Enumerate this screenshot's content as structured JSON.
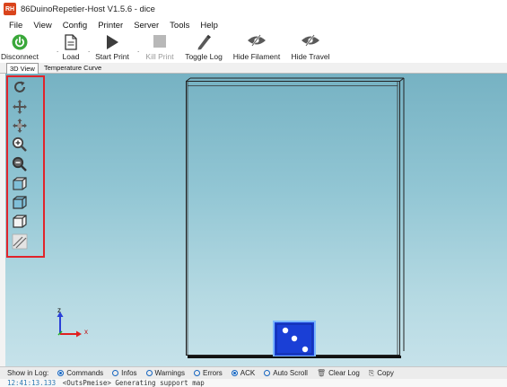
{
  "window": {
    "title": "86DuinoRepetier-Host V1.5.6 - dice",
    "app_icon": "app-logo-icon"
  },
  "menu": [
    "File",
    "View",
    "Config",
    "Printer",
    "Server",
    "Tools",
    "Help"
  ],
  "toolbar": {
    "disconnect_label": "Disconnect",
    "load_label": "Load",
    "start_print_label": "Start Print",
    "kill_print_label": "Kill Print",
    "toggle_log_label": "Toggle Log",
    "hide_filament_label": "Hide Filament",
    "hide_travel_label": "Hide Travel"
  },
  "tabs": [
    "3D View",
    "Temperature Curve"
  ],
  "view_tools": [
    "reset-view-icon",
    "move-icon",
    "move-object-icon",
    "zoom-in-icon",
    "zoom-out-icon",
    "iso-view-icon",
    "front-view-icon",
    "side-view-icon",
    "slice-view-icon"
  ],
  "axis": {
    "z_label": "z",
    "x_label": "x"
  },
  "log": {
    "show_in_log_label": "Show in Log:",
    "options": [
      {
        "label": "Commands",
        "checked": true
      },
      {
        "label": "Infos",
        "checked": false
      },
      {
        "label": "Warnings",
        "checked": false
      },
      {
        "label": "Errors",
        "checked": false
      },
      {
        "label": "ACK",
        "checked": true
      },
      {
        "label": "Auto Scroll",
        "checked": false
      }
    ],
    "clear_log_label": "Clear Log",
    "copy_label": "Copy",
    "last_timestamp": "12:41:13.133",
    "last_message": "<OutsPmeise> Generating support map"
  },
  "colors": {
    "accent_red": "#e0242b",
    "connect_green": "#3aa83a",
    "dice_blue": "#1a3fd6",
    "radio_blue": "#1565c0"
  }
}
